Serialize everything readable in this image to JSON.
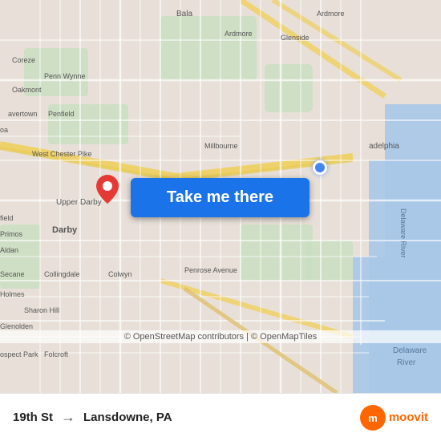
{
  "map": {
    "attribution": "© OpenStreetMap contributors | © OpenMapTiles",
    "background_color": "#e8e0d8"
  },
  "button": {
    "label": "Take me there"
  },
  "footer": {
    "from_label": "19th St",
    "to_label": "Lansdowne, PA",
    "arrow": "→",
    "moovit_text": "moovit"
  },
  "icons": {
    "location_pin": "📍",
    "blue_dot": "blue-dot",
    "moovit_initial": "m"
  }
}
